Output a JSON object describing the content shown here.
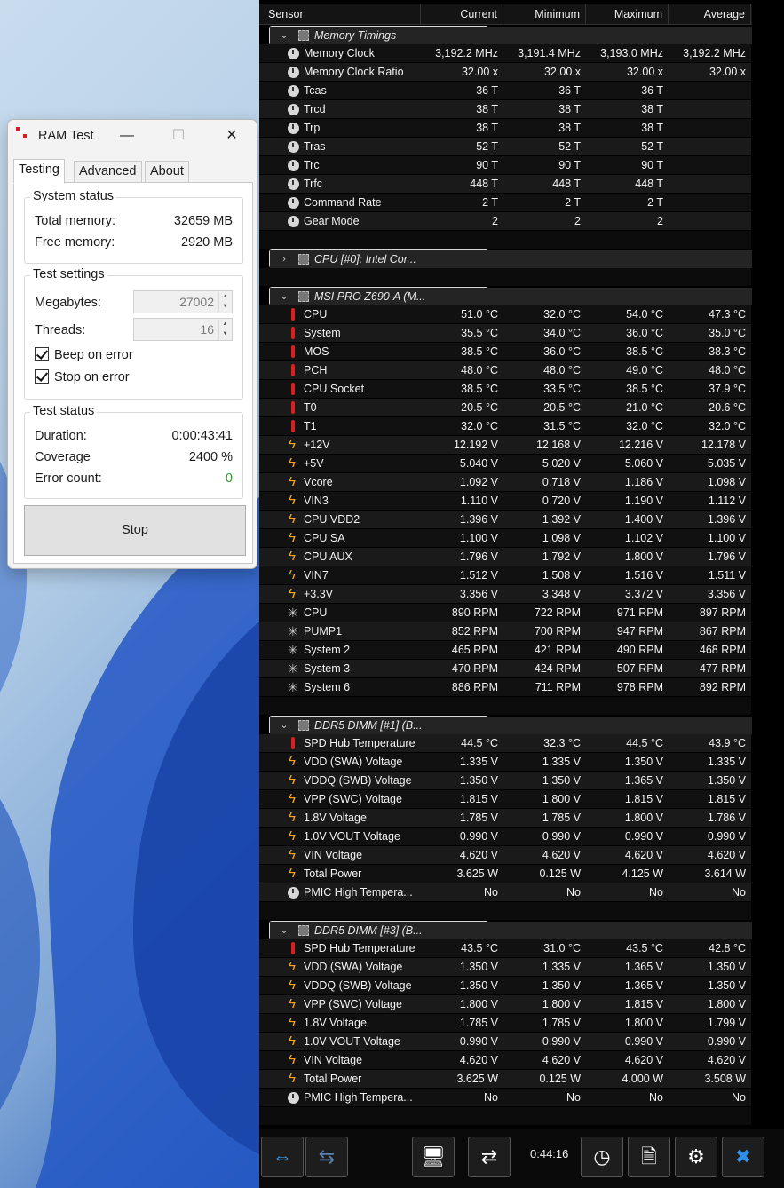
{
  "ram": {
    "title": "RAM Test",
    "tabs": [
      "Testing",
      "Advanced",
      "About"
    ],
    "system_status": {
      "title": "System status",
      "total_label": "Total memory:",
      "total_value": "32659 MB",
      "free_label": "Free memory:",
      "free_value": "2920 MB"
    },
    "test_settings": {
      "title": "Test settings",
      "mb_label": "Megabytes:",
      "mb_value": "27002",
      "threads_label": "Threads:",
      "threads_value": "16",
      "beep_label": "Beep on error",
      "stop_label": "Stop on error"
    },
    "test_status": {
      "title": "Test status",
      "duration_label": "Duration:",
      "duration_value": "0:00:43:41",
      "coverage_label": "Coverage",
      "coverage_value": "2400 %",
      "errors_label": "Error count:",
      "errors_value": "0"
    },
    "stop_button": "Stop"
  },
  "hw": {
    "headers": [
      "Sensor",
      "Current",
      "Minimum",
      "Maximum",
      "Average"
    ],
    "clock": "0:44:16",
    "rows": [
      {
        "t": "group",
        "open": true,
        "name": "Memory Timings"
      },
      {
        "t": "clock",
        "name": "Memory Clock",
        "cur": "3,192.2 MHz",
        "min": "3,191.4 MHz",
        "max": "3,193.0 MHz",
        "avg": "3,192.2 MHz"
      },
      {
        "t": "clock",
        "name": "Memory Clock Ratio",
        "cur": "32.00 x",
        "min": "32.00 x",
        "max": "32.00 x",
        "avg": "32.00 x"
      },
      {
        "t": "clock",
        "name": "Tcas",
        "cur": "36 T",
        "min": "36 T",
        "max": "36 T",
        "avg": ""
      },
      {
        "t": "clock",
        "name": "Trcd",
        "cur": "38 T",
        "min": "38 T",
        "max": "38 T",
        "avg": ""
      },
      {
        "t": "clock",
        "name": "Trp",
        "cur": "38 T",
        "min": "38 T",
        "max": "38 T",
        "avg": ""
      },
      {
        "t": "clock",
        "name": "Tras",
        "cur": "52 T",
        "min": "52 T",
        "max": "52 T",
        "avg": ""
      },
      {
        "t": "clock",
        "name": "Trc",
        "cur": "90 T",
        "min": "90 T",
        "max": "90 T",
        "avg": ""
      },
      {
        "t": "clock",
        "name": "Trfc",
        "cur": "448 T",
        "min": "448 T",
        "max": "448 T",
        "avg": ""
      },
      {
        "t": "clock",
        "name": "Command Rate",
        "cur": "2 T",
        "min": "2 T",
        "max": "2 T",
        "avg": ""
      },
      {
        "t": "clock",
        "name": "Gear Mode",
        "cur": "2",
        "min": "2",
        "max": "2",
        "avg": ""
      },
      {
        "t": "blank"
      },
      {
        "t": "group",
        "open": false,
        "name": "CPU [#0]: Intel Cor..."
      },
      {
        "t": "blank"
      },
      {
        "t": "group",
        "open": true,
        "name": "MSI PRO Z690-A (M..."
      },
      {
        "t": "therm",
        "name": "CPU",
        "cur": "51.0 °C",
        "min": "32.0 °C",
        "max": "54.0 °C",
        "avg": "47.3 °C"
      },
      {
        "t": "therm",
        "name": "System",
        "cur": "35.5 °C",
        "min": "34.0 °C",
        "max": "36.0 °C",
        "avg": "35.0 °C"
      },
      {
        "t": "therm",
        "name": "MOS",
        "cur": "38.5 °C",
        "min": "36.0 °C",
        "max": "38.5 °C",
        "avg": "38.3 °C"
      },
      {
        "t": "therm",
        "name": "PCH",
        "cur": "48.0 °C",
        "min": "48.0 °C",
        "max": "49.0 °C",
        "avg": "48.0 °C"
      },
      {
        "t": "therm",
        "name": "CPU Socket",
        "cur": "38.5 °C",
        "min": "33.5 °C",
        "max": "38.5 °C",
        "avg": "37.9 °C"
      },
      {
        "t": "therm",
        "name": "T0",
        "cur": "20.5 °C",
        "min": "20.5 °C",
        "max": "21.0 °C",
        "avg": "20.6 °C"
      },
      {
        "t": "therm",
        "name": "T1",
        "cur": "32.0 °C",
        "min": "31.5 °C",
        "max": "32.0 °C",
        "avg": "32.0 °C"
      },
      {
        "t": "volt",
        "name": "+12V",
        "cur": "12.192 V",
        "min": "12.168 V",
        "max": "12.216 V",
        "avg": "12.178 V"
      },
      {
        "t": "volt",
        "name": "+5V",
        "cur": "5.040 V",
        "min": "5.020 V",
        "max": "5.060 V",
        "avg": "5.035 V"
      },
      {
        "t": "volt",
        "name": "Vcore",
        "cur": "1.092 V",
        "min": "0.718 V",
        "max": "1.186 V",
        "avg": "1.098 V"
      },
      {
        "t": "volt",
        "name": "VIN3",
        "cur": "1.110 V",
        "min": "0.720 V",
        "max": "1.190 V",
        "avg": "1.112 V"
      },
      {
        "t": "volt",
        "name": "CPU VDD2",
        "cur": "1.396 V",
        "min": "1.392 V",
        "max": "1.400 V",
        "avg": "1.396 V"
      },
      {
        "t": "volt",
        "name": "CPU SA",
        "cur": "1.100 V",
        "min": "1.098 V",
        "max": "1.102 V",
        "avg": "1.100 V"
      },
      {
        "t": "volt",
        "name": "CPU AUX",
        "cur": "1.796 V",
        "min": "1.792 V",
        "max": "1.800 V",
        "avg": "1.796 V"
      },
      {
        "t": "volt",
        "name": "VIN7",
        "cur": "1.512 V",
        "min": "1.508 V",
        "max": "1.516 V",
        "avg": "1.511 V"
      },
      {
        "t": "volt",
        "name": "+3.3V",
        "cur": "3.356 V",
        "min": "3.348 V",
        "max": "3.372 V",
        "avg": "3.356 V"
      },
      {
        "t": "fan",
        "name": "CPU",
        "cur": "890 RPM",
        "min": "722 RPM",
        "max": "971 RPM",
        "avg": "897 RPM"
      },
      {
        "t": "fan",
        "name": "PUMP1",
        "cur": "852 RPM",
        "min": "700 RPM",
        "max": "947 RPM",
        "avg": "867 RPM"
      },
      {
        "t": "fan",
        "name": "System 2",
        "cur": "465 RPM",
        "min": "421 RPM",
        "max": "490 RPM",
        "avg": "468 RPM"
      },
      {
        "t": "fan",
        "name": "System 3",
        "cur": "470 RPM",
        "min": "424 RPM",
        "max": "507 RPM",
        "avg": "477 RPM"
      },
      {
        "t": "fan",
        "name": "System 6",
        "cur": "886 RPM",
        "min": "711 RPM",
        "max": "978 RPM",
        "avg": "892 RPM"
      },
      {
        "t": "blank"
      },
      {
        "t": "group",
        "open": true,
        "name": "DDR5 DIMM [#1] (B..."
      },
      {
        "t": "therm",
        "name": "SPD Hub Temperature",
        "cur": "44.5 °C",
        "min": "32.3 °C",
        "max": "44.5 °C",
        "avg": "43.9 °C"
      },
      {
        "t": "volt",
        "name": "VDD (SWA) Voltage",
        "cur": "1.335 V",
        "min": "1.335 V",
        "max": "1.350 V",
        "avg": "1.335 V"
      },
      {
        "t": "volt",
        "name": "VDDQ (SWB) Voltage",
        "cur": "1.350 V",
        "min": "1.350 V",
        "max": "1.365 V",
        "avg": "1.350 V"
      },
      {
        "t": "volt",
        "name": "VPP (SWC) Voltage",
        "cur": "1.815 V",
        "min": "1.800 V",
        "max": "1.815 V",
        "avg": "1.815 V"
      },
      {
        "t": "volt",
        "name": "1.8V Voltage",
        "cur": "1.785 V",
        "min": "1.785 V",
        "max": "1.800 V",
        "avg": "1.786 V"
      },
      {
        "t": "volt",
        "name": "1.0V VOUT Voltage",
        "cur": "0.990 V",
        "min": "0.990 V",
        "max": "0.990 V",
        "avg": "0.990 V"
      },
      {
        "t": "volt",
        "name": "VIN Voltage",
        "cur": "4.620 V",
        "min": "4.620 V",
        "max": "4.620 V",
        "avg": "4.620 V"
      },
      {
        "t": "volt",
        "name": "Total Power",
        "cur": "3.625 W",
        "min": "0.125 W",
        "max": "4.125 W",
        "avg": "3.614 W"
      },
      {
        "t": "clock",
        "name": "PMIC High Tempera...",
        "cur": "No",
        "min": "No",
        "max": "No",
        "avg": "No"
      },
      {
        "t": "blank"
      },
      {
        "t": "group",
        "open": true,
        "name": "DDR5 DIMM [#3] (B..."
      },
      {
        "t": "therm",
        "name": "SPD Hub Temperature",
        "cur": "43.5 °C",
        "min": "31.0 °C",
        "max": "43.5 °C",
        "avg": "42.8 °C"
      },
      {
        "t": "volt",
        "name": "VDD (SWA) Voltage",
        "cur": "1.350 V",
        "min": "1.335 V",
        "max": "1.365 V",
        "avg": "1.350 V"
      },
      {
        "t": "volt",
        "name": "VDDQ (SWB) Voltage",
        "cur": "1.350 V",
        "min": "1.350 V",
        "max": "1.365 V",
        "avg": "1.350 V"
      },
      {
        "t": "volt",
        "name": "VPP (SWC) Voltage",
        "cur": "1.800 V",
        "min": "1.800 V",
        "max": "1.815 V",
        "avg": "1.800 V"
      },
      {
        "t": "volt",
        "name": "1.8V Voltage",
        "cur": "1.785 V",
        "min": "1.785 V",
        "max": "1.800 V",
        "avg": "1.799 V"
      },
      {
        "t": "volt",
        "name": "1.0V VOUT Voltage",
        "cur": "0.990 V",
        "min": "0.990 V",
        "max": "0.990 V",
        "avg": "0.990 V"
      },
      {
        "t": "volt",
        "name": "VIN Voltage",
        "cur": "4.620 V",
        "min": "4.620 V",
        "max": "4.620 V",
        "avg": "4.620 V"
      },
      {
        "t": "volt",
        "name": "Total Power",
        "cur": "3.625 W",
        "min": "0.125 W",
        "max": "4.000 W",
        "avg": "3.508 W"
      },
      {
        "t": "clock",
        "name": "PMIC High Tempera...",
        "cur": "No",
        "min": "No",
        "max": "No",
        "avg": "No"
      },
      {
        "t": "blank"
      }
    ]
  }
}
